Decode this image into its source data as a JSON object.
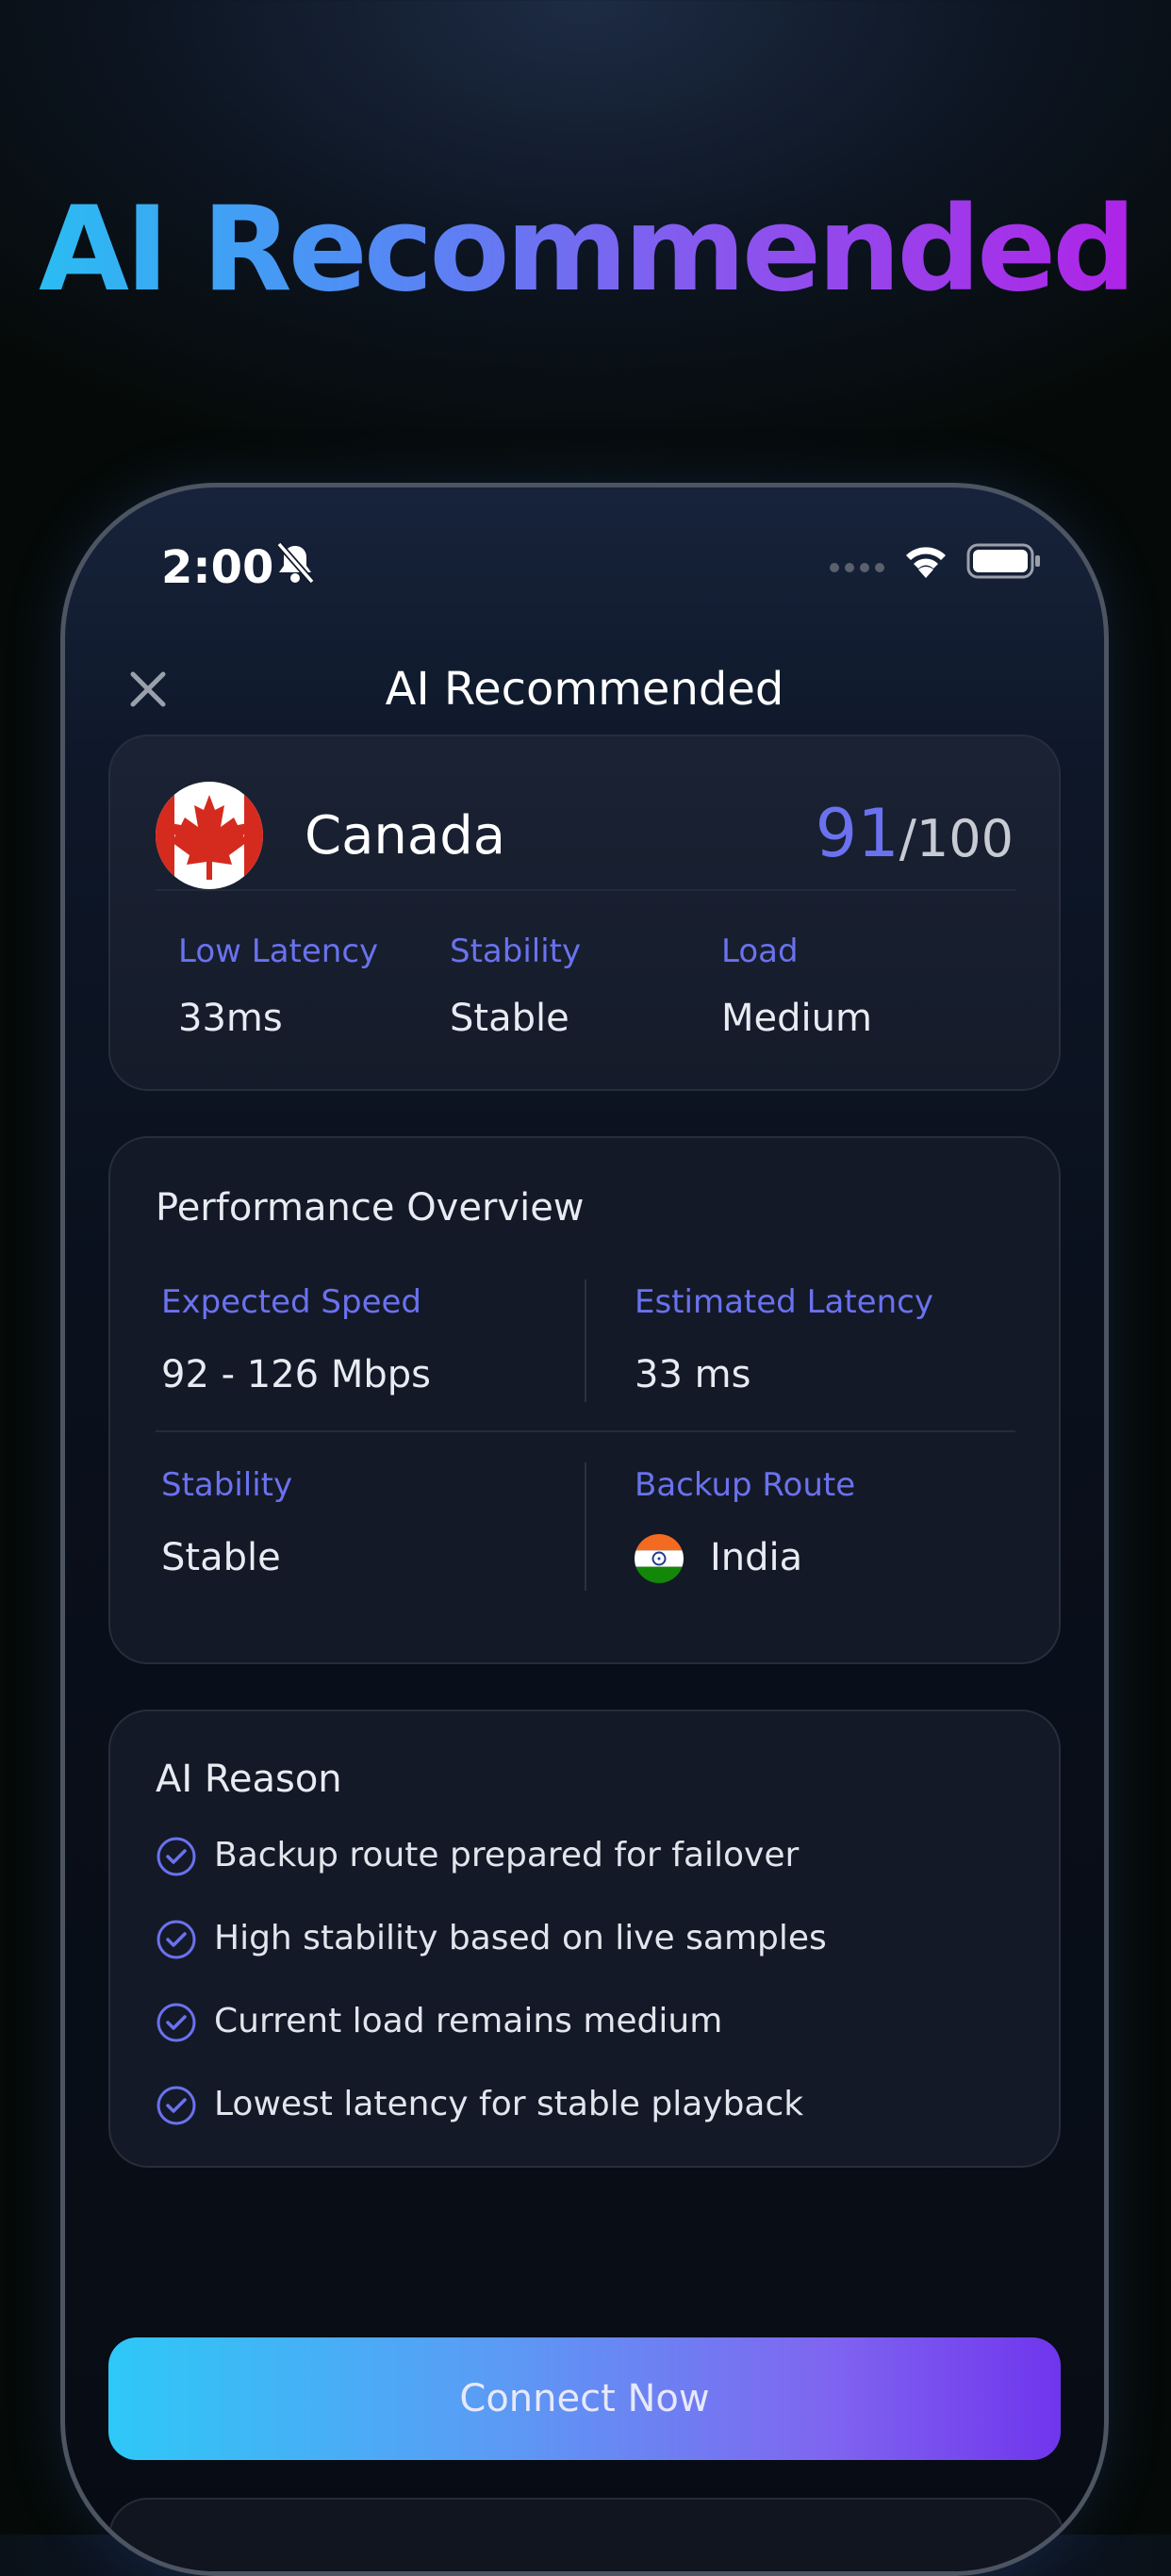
{
  "hero": {
    "title": "AI Recommended"
  },
  "status_bar": {
    "time": "2:00"
  },
  "nav": {
    "title": "AI Recommended"
  },
  "recommendation": {
    "country": "Canada",
    "score": "91",
    "score_max": "/100",
    "metrics": [
      {
        "label": "Low Latency",
        "value": "33ms"
      },
      {
        "label": "Stability",
        "value": "Stable"
      },
      {
        "label": "Load",
        "value": "Medium"
      }
    ]
  },
  "performance": {
    "title": "Performance Overview",
    "expected_speed": {
      "label": "Expected Speed",
      "value": "92 - 126 Mbps"
    },
    "estimated_latency": {
      "label": "Estimated Latency",
      "value": "33 ms"
    },
    "stability": {
      "label": "Stability",
      "value": "Stable"
    },
    "backup_route": {
      "label": "Backup Route",
      "value": "India"
    }
  },
  "ai_reason": {
    "title": "AI Reason",
    "items": [
      "Backup route prepared for failover",
      "High stability based on live samples",
      "Current load remains medium",
      "Lowest latency for stable playback"
    ]
  },
  "actions": {
    "connect_label": "Connect Now"
  },
  "colors": {
    "accent": "#6a72ee",
    "gradient_start": "#2ec8f7",
    "gradient_end": "#7035ed"
  }
}
